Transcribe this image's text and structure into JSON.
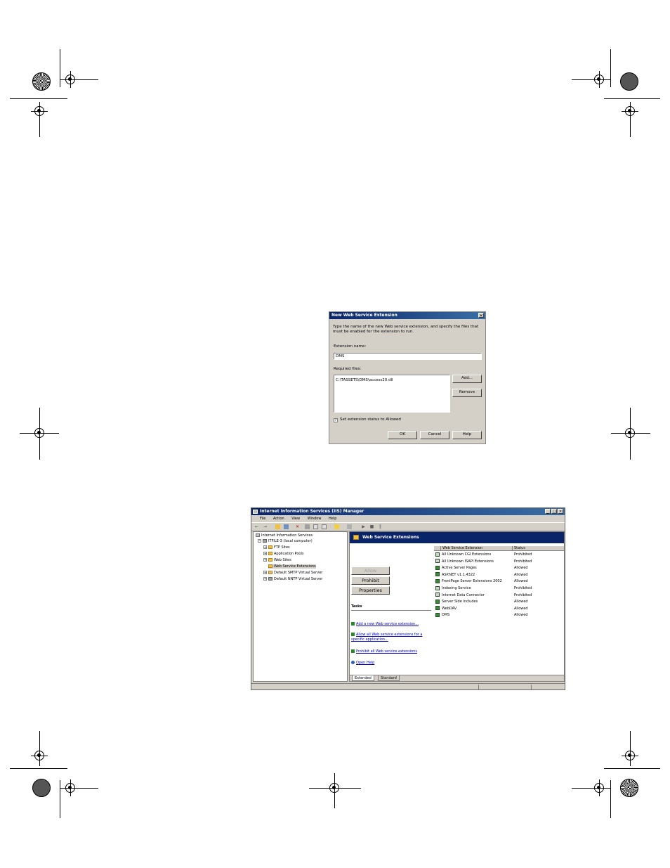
{
  "dialog": {
    "title": "New Web Service Extension",
    "close_glyph": "✕",
    "instructions": "Type the name of the new Web service extension, and specify the files that must be enabled for the extension to run.",
    "extension_name_label": "Extension name:",
    "extension_name_value": "DMS",
    "required_files_label": "Required files:",
    "required_files": [
      "C:\\TASSETS\\DMS\\access20.dll"
    ],
    "add_button": "Add...",
    "remove_button": "Remove",
    "checkbox_label": "Set extension status to Allowed",
    "checkbox_checked": true,
    "ok_button": "OK",
    "cancel_button": "Cancel",
    "help_button": "Help"
  },
  "iis": {
    "title": "Internet Information Services (IIS) Manager",
    "window_buttons": {
      "minimize": "_",
      "restore": "□",
      "close": "✕"
    },
    "menu": [
      "File",
      "Action",
      "View",
      "Window",
      "Help"
    ],
    "tree": {
      "root": "Internet Information Services",
      "computer": "ITFILE-3 (local computer)",
      "items": [
        "FTP Sites",
        "Application Pools",
        "Web Sites",
        "Web Service Extensions",
        "Default SMTP Virtual Server",
        "Default NNTP Virtual Server"
      ]
    },
    "pane_title": "Web Service Extensions",
    "buttons": {
      "allow": "Allow",
      "prohibit": "Prohibit",
      "properties": "Properties"
    },
    "tasks_label": "Tasks",
    "links": [
      "Add a new Web service extension...",
      "Allow all Web service extensions for a specific application...",
      "Prohibit all Web service extensions",
      "Open Help"
    ],
    "columns": [
      "Web Service Extension",
      "Status"
    ],
    "extensions": [
      {
        "name": "All Unknown CGI Extensions",
        "status": "Prohibited"
      },
      {
        "name": "All Unknown ISAPI Extensions",
        "status": "Prohibited"
      },
      {
        "name": "Active Server Pages",
        "status": "Allowed"
      },
      {
        "name": "ASP.NET v1.1.4322",
        "status": "Allowed"
      },
      {
        "name": "FrontPage Server Extensions 2002",
        "status": "Allowed"
      },
      {
        "name": "Indexing Service",
        "status": "Prohibited"
      },
      {
        "name": "Internet Data Connector",
        "status": "Prohibited"
      },
      {
        "name": "Server Side Includes",
        "status": "Allowed"
      },
      {
        "name": "WebDAV",
        "status": "Allowed"
      },
      {
        "name": "DMS",
        "status": "Allowed"
      }
    ],
    "tabs": [
      "Extended",
      "Standard"
    ]
  }
}
